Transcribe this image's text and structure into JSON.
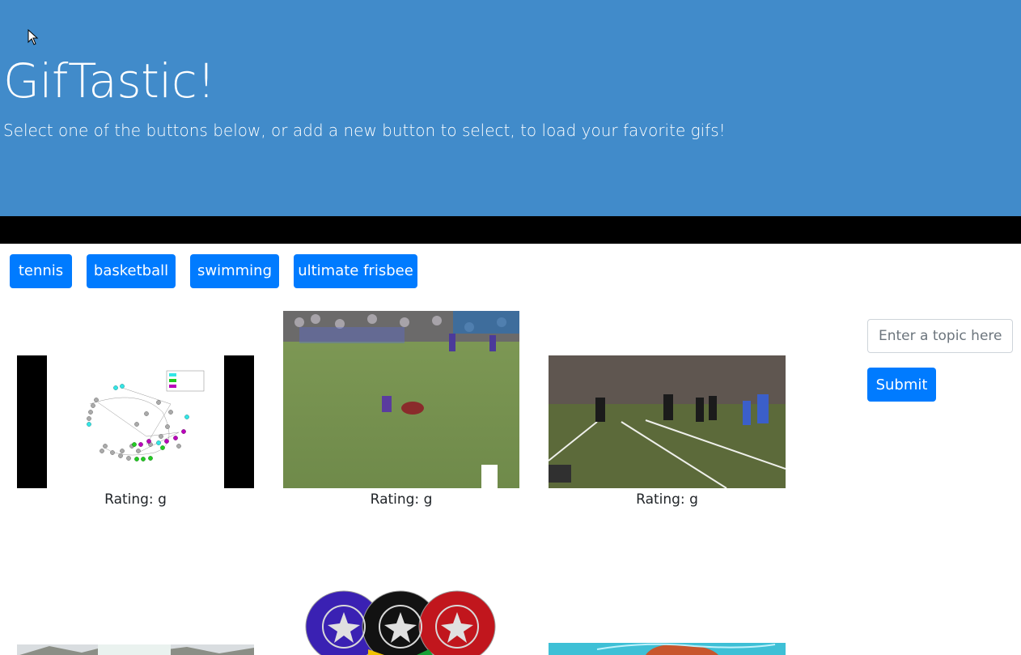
{
  "header": {
    "title": "GifTastic!",
    "subtitle": "Select one of the buttons below, or add a new button to select, to load your favorite gifs!",
    "background_color": "#418bca"
  },
  "topics": [
    {
      "label": "tennis"
    },
    {
      "label": "basketball"
    },
    {
      "label": "swimming"
    },
    {
      "label": "ultimate frisbee"
    }
  ],
  "button_color": "#007bff",
  "form": {
    "placeholder": "Enter a topic here",
    "value": "",
    "submit_label": "Submit"
  },
  "gifs": [
    {
      "rating": "Rating: g",
      "content": "ultimate frisbee ranking scatter chart animation"
    },
    {
      "rating": "Rating: g",
      "content": "ultimate frisbee player diving on grass field"
    },
    {
      "rating": "Rating: g",
      "content": "ultimate frisbee players on indoor turf field"
    },
    {
      "rating": null,
      "content": "outdoor trees scene (partially visible)"
    },
    {
      "rating": null,
      "content": "three frisbee discs: purple, black, red"
    },
    {
      "rating": null,
      "content": "cartoon character (partially visible)"
    }
  ]
}
